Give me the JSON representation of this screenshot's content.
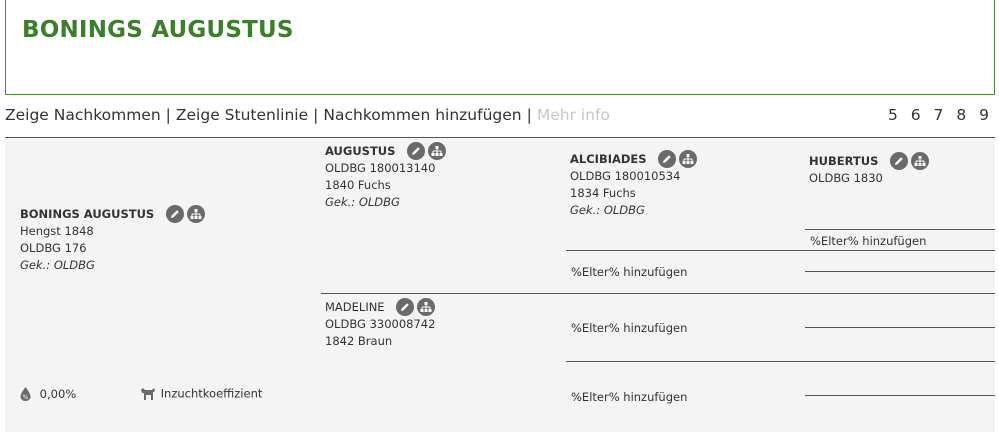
{
  "title": "BONINGS AUGUSTUS",
  "nav": {
    "links": [
      "Zeige Nachkommen",
      "Zeige Stutenlinie",
      "Nachkommen hinzufügen"
    ],
    "more_info": "Mehr info",
    "generations": "5 6 7 8 9"
  },
  "subject": {
    "name": "BONINGS AUGUSTUS",
    "line1": "Hengst 1848",
    "line2": "OLDBG 176",
    "line3": "Gek.: OLDBG"
  },
  "sire": {
    "name": "AUGUSTUS",
    "line1": "OLDBG 180013140",
    "line2": "1840 Fuchs",
    "line3": "Gek.: OLDBG"
  },
  "dam": {
    "name": "MADELINE",
    "line1": "OLDBG 330008742",
    "line2": "1842 Braun"
  },
  "sire_sire": {
    "name": "ALCIBIADES",
    "line1": "OLDBG 180010534",
    "line2": "1834 Fuchs",
    "line3": "Gek.: OLDBG"
  },
  "sire_sire_sire": {
    "name": "HUBERTUS",
    "line1": "OLDBG 1830"
  },
  "add_parent_label": "%Elter% hinzufügen",
  "footer": {
    "inbreeding_value": "0,00%",
    "inbreeding_label": "Inzuchtkoeffizient"
  },
  "colors": {
    "title_green": "#3b7f2a",
    "icon_gray": "#6a6a6a",
    "tree_background": "#f4f4f4"
  }
}
